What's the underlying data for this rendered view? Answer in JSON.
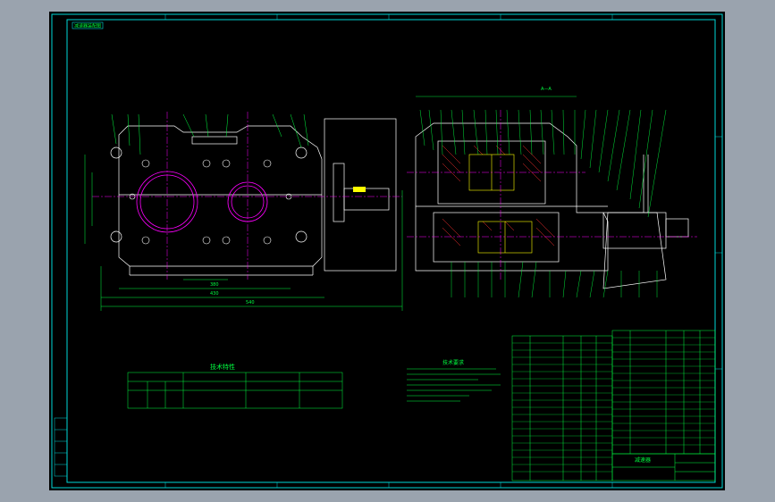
{
  "window": {
    "title": ""
  },
  "drawing": {
    "colors": {
      "background": "#000000",
      "frame": "#00d8d8",
      "part": "#ffffff",
      "center_line": "#ff00ff",
      "dimension": "#00ff40",
      "hatch": "#ff3030",
      "text": "#00ff40",
      "yellow": "#ffff00"
    },
    "tag": "减速器装配图",
    "section_label": "A—A",
    "tech_spec_title": "技术特性",
    "tech_requirements_title": "技术要求",
    "title_block_name": "减速器"
  }
}
